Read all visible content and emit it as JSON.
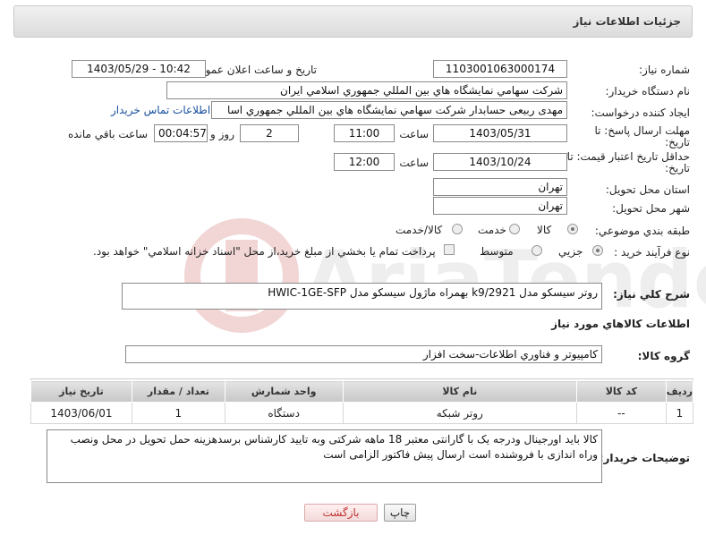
{
  "header": {
    "title": "جزئيات اطلاعات نياز"
  },
  "fields": {
    "need_number_label": "شماره نياز:",
    "need_number": "1103001063000174",
    "announce_label": "تاريخ و ساعت اعلان عمومي:",
    "announce_value": "1403/05/29 - 10:42",
    "buyer_org_label": "نام دستگاه خريدار:",
    "buyer_org": "شرکت سهامي نمايشگاه هاي بين المللي جمهوري اسلامي ايران",
    "creator_label": "ايجاد کننده درخواست:",
    "creator": "مهدی ربیعی حسابدار شرکت سهامي نمايشگاه هاي بين المللي جمهوري اسا",
    "buyer_contact_link": "اطلاعات تماس خريدار",
    "deadline_label_1": "مهلت ارسال پاسخ: تا",
    "deadline_label_2": "تاريخ:",
    "deadline_date": "1403/05/31",
    "time_label": "ساعت",
    "deadline_time": "11:00",
    "days_value": "2",
    "days_label": "روز و",
    "remaining_value": "00:04:57",
    "remaining_label": "ساعت باقي مانده",
    "validity_label_1": "حداقل تاريخ اعتبار قيمت: تا",
    "validity_label_2": "تاريخ:",
    "validity_date": "1403/10/24",
    "validity_time": "12:00",
    "province_label": "استان محل تحويل:",
    "province": "تهران",
    "city_label": "شهر محل تحويل:",
    "city": "تهران",
    "category_label": "طبقه بندي موضوعي:",
    "category_options": [
      "کالا",
      "خدمت",
      "کالا/خدمت"
    ],
    "process_label": "نوع فرآيند خريد :",
    "process_options": [
      "جزيي",
      "متوسط"
    ],
    "process_note": "پرداخت تمام يا بخشي از مبلغ خريد،از محل \"اسناد خزانه اسلامي\" خواهد بود."
  },
  "description": {
    "label": "شرح کلي نياز:",
    "value": "روتر سیسکو مدل k9/2921 بهمراه ماژول سیسکو مدل HWIC-1GE-SFP"
  },
  "goods_section_title": "اطلاعات کالاهاي مورد نياز",
  "goods_group": {
    "label": "گروه کالا:",
    "value": "کامپيوتر و فناوري اطلاعات-سخت افزار"
  },
  "table": {
    "headers": [
      "رديف",
      "کد کالا",
      "نام کالا",
      "واحد شمارش",
      "تعداد / مقدار",
      "تاريخ نياز"
    ],
    "rows": [
      [
        "1",
        "--",
        "روتر شبکه",
        "دستگاه",
        "1",
        "1403/06/01"
      ]
    ]
  },
  "buyer_notes": {
    "label": "توضيحات خريدار:",
    "value": "کالا باید اورجینال ودرجه یک با گارانتی معتبر 18 ماهه شرکتی وبه تایید کارشناس برسدهزینه حمل تحویل در محل ونصب وراه اندازی با فروشنده است ارسال پیش فاکتور الزامی است"
  },
  "buttons": {
    "print": "چاپ",
    "back": "بازگشت"
  },
  "watermark": {
    "text": "AriaTender.neT"
  }
}
